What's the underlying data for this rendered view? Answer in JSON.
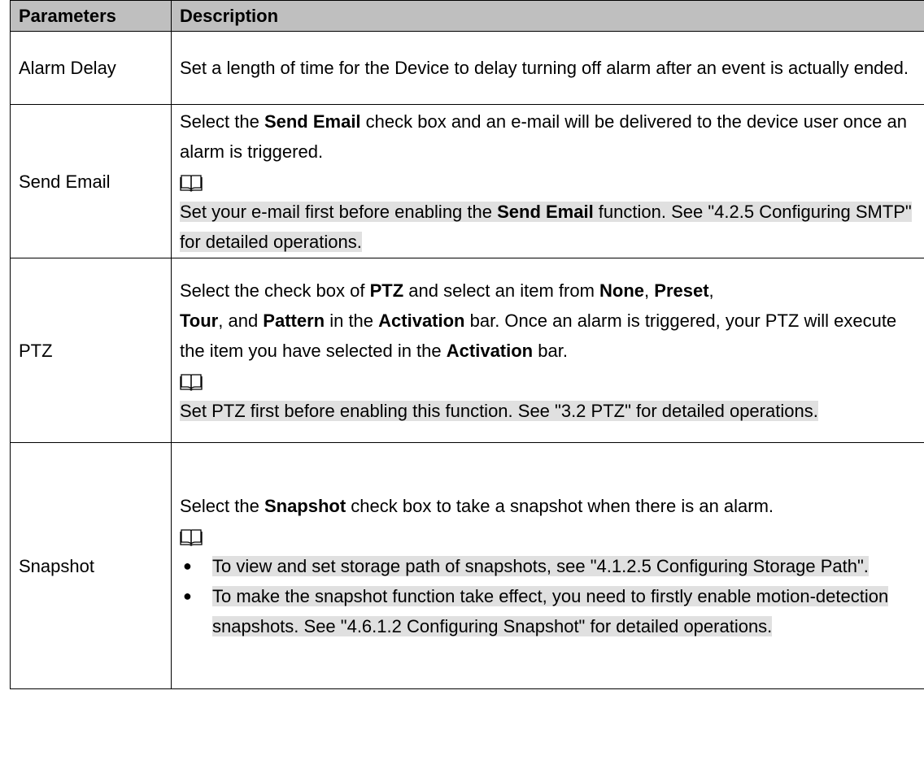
{
  "table": {
    "header": {
      "col1": "Parameters",
      "col2": "Description"
    },
    "rows": {
      "alarm_delay": {
        "name": "Alarm Delay",
        "text": "Set a length of time for the Device to delay turning off alarm after an event is actually ended."
      },
      "send_email": {
        "name": "Send Email",
        "p1_a": "Select the ",
        "p1_b": "Send Email",
        "p1_c": " check box and an e-mail will be delivered to the device user once an alarm is triggered.",
        "note_a": "Set your e-mail first before enabling the ",
        "note_b": "Send Email",
        "note_c": " function. See \"4.2.5 Configuring SMTP\" for detailed operations."
      },
      "ptz": {
        "name": "PTZ",
        "p1_a": "Select the check box of ",
        "p1_b": "PTZ",
        "p1_c": " and select an item from ",
        "p1_d": "None",
        "p1_e": ", ",
        "p1_f": "Preset",
        "p1_g": ", ",
        "p1_h": "Tour",
        "p1_i": ", and ",
        "p1_j": "Pattern",
        "p1_k": " in the ",
        "p1_l": "Activation",
        "p1_m": " bar. Once an alarm is triggered, your PTZ will execute the item you have selected in the ",
        "p1_n": "Activation",
        "p1_o": " bar.",
        "note": "Set PTZ first before enabling this function. See \"3.2 PTZ\" for detailed operations."
      },
      "snapshot": {
        "name": "Snapshot",
        "p1_a": "Select the ",
        "p1_b": "Snapshot",
        "p1_c": " check box to take a snapshot when there is an alarm.",
        "bullet_glyph": "●",
        "bullets": [
          "To view and set storage path of snapshots, see \"4.1.2.5 Configuring Storage Path\".",
          "To make the snapshot function take effect, you need to firstly enable motion-detection snapshots. See \"4.6.1.2 Configuring Snapshot\" for detailed operations."
        ]
      }
    }
  },
  "icons": {
    "note": "open-book-note-icon"
  },
  "colors": {
    "header_bg": "#bfbfbf",
    "note_highlight": "#e0e0e0",
    "border": "#000000"
  }
}
